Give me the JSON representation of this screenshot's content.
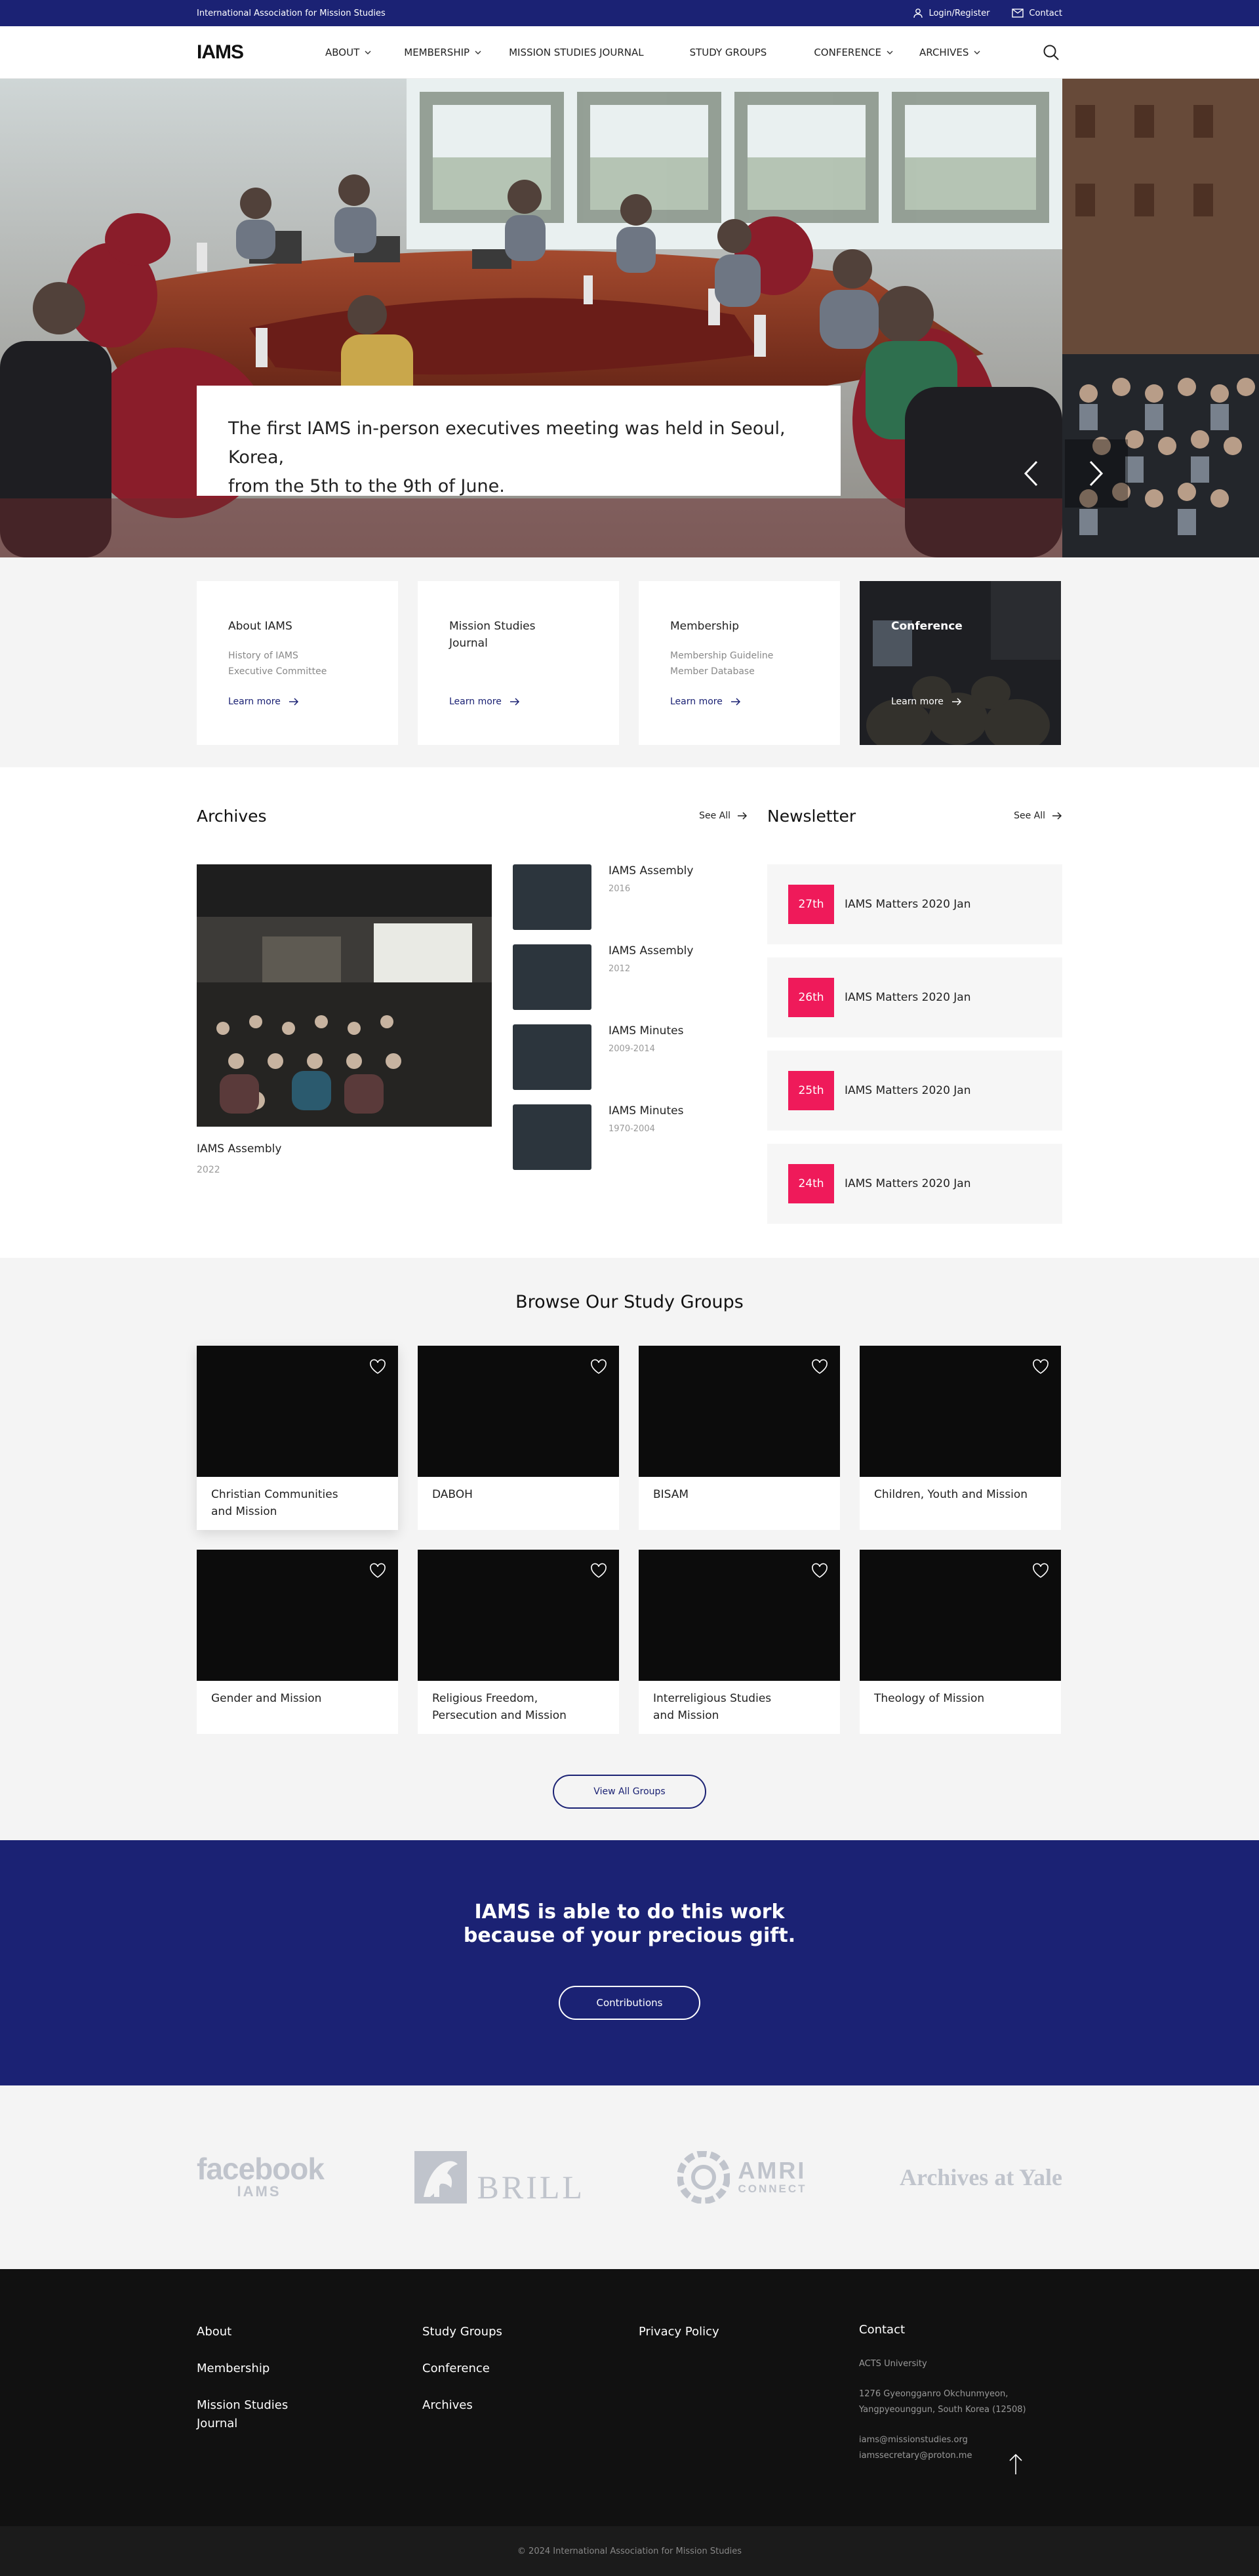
{
  "topbar": {
    "org_name": "International Association for Mission Studies",
    "login_label": "Login/Register",
    "contact_label": "Contact"
  },
  "header": {
    "logo": "IAMS",
    "nav": [
      {
        "label": "ABOUT",
        "has_dropdown": true
      },
      {
        "label": "MEMBERSHIP",
        "has_dropdown": true
      },
      {
        "label": "MISSION STUDIES JOURNAL",
        "has_dropdown": false
      },
      {
        "label": "STUDY GROUPS",
        "has_dropdown": false
      },
      {
        "label": "CONFERENCE",
        "has_dropdown": true
      },
      {
        "label": "ARCHIVES",
        "has_dropdown": true
      }
    ]
  },
  "hero": {
    "caption_line1": "The first IAMS in-person executives meeting was held in Seoul, Korea,",
    "caption_line2": "from the 5th to the 9th of June."
  },
  "quick_cards": [
    {
      "title": "About IAMS",
      "sub": [
        "History of IAMS",
        "Executive Committee"
      ],
      "link": "Learn more"
    },
    {
      "title": "Mission Studies Journal",
      "sub": [],
      "link": "Learn more"
    },
    {
      "title": "Membership",
      "sub": [
        "Membership Guideline",
        "Member Database"
      ],
      "link": "Learn more"
    },
    {
      "title": "Conference",
      "sub": [],
      "link": "Learn more"
    }
  ],
  "archives": {
    "heading": "Archives",
    "see_all": "See All",
    "featured": {
      "title": "IAMS Assembly",
      "year": "2022"
    },
    "items": [
      {
        "title": "IAMS Assembly",
        "year": "2016"
      },
      {
        "title": "IAMS Assembly",
        "year": "2012"
      },
      {
        "title": "IAMS Minutes",
        "year": "2009-2014"
      },
      {
        "title": "IAMS Minutes",
        "year": "1970-2004"
      }
    ]
  },
  "newsletter": {
    "heading": "Newsletter",
    "see_all": "See All",
    "items": [
      {
        "day": "27th",
        "title": "IAMS Matters 2020 Jan"
      },
      {
        "day": "26th",
        "title": "IAMS Matters 2020 Jan"
      },
      {
        "day": "25th",
        "title": "IAMS Matters 2020 Jan"
      },
      {
        "day": "24th",
        "title": "IAMS Matters 2020 Jan"
      }
    ]
  },
  "study_groups": {
    "heading": "Browse Our Study Groups",
    "groups": [
      {
        "line1": "Christian Communities",
        "line2": "and Mission"
      },
      {
        "line1": "DABOH",
        "line2": ""
      },
      {
        "line1": "BISAM",
        "line2": ""
      },
      {
        "line1": "Children, Youth and Mission",
        "line2": ""
      },
      {
        "line1": "Gender and Mission",
        "line2": ""
      },
      {
        "line1": "Religious Freedom,",
        "line2": "Persecution and Mission"
      },
      {
        "line1": "Interreligious Studies",
        "line2": "and Mission"
      },
      {
        "line1": "Theology of Mission",
        "line2": ""
      }
    ],
    "view_all": "View All Groups"
  },
  "donate": {
    "line1": "IAMS is able to do this work",
    "line2": "because of your precious gift.",
    "button": "Contributions"
  },
  "partners": {
    "facebook_word": "facebook",
    "facebook_sub": "IAMS",
    "brill": "BRILL",
    "amri_word": "AMRI",
    "amri_sub": "CONNECT",
    "yale": "Archives at Yale"
  },
  "footer": {
    "col1": [
      "About",
      "Membership",
      "Mission Studies Journal"
    ],
    "col2": [
      "Study Groups",
      "Conference",
      "Archives"
    ],
    "col3": [
      "Privacy Policy"
    ],
    "contact_heading": "Contact",
    "contact_org": "ACTS University",
    "contact_address1": "1276 Gyeongganro Okchunmyeon,",
    "contact_address2": "Yangpyeounggun, South Korea (12508)",
    "contact_email1": "iams@missionstudies.org",
    "contact_email2": "iamssecretary@proton.me"
  },
  "copyright": "© 2024 International Association for Mission Studies",
  "colors": {
    "brand": "#1b2274",
    "badge": "#ef1a5a",
    "footer": "#111111"
  }
}
